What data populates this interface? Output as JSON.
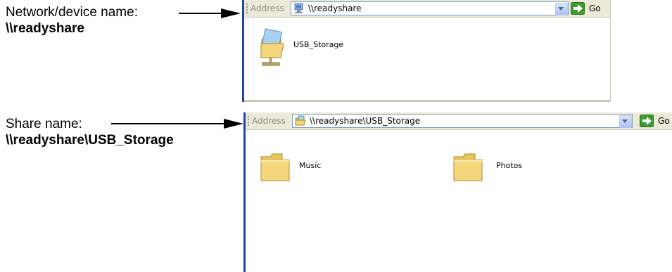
{
  "callouts": {
    "network": {
      "label": "Network/device name:",
      "value": "\\\\readyshare"
    },
    "share": {
      "label": "Share name:",
      "value": "\\\\readyshare\\USB_Storage"
    }
  },
  "window1": {
    "address_label": "Address",
    "address_value": "\\\\readyshare",
    "go_label": "Go",
    "items": [
      {
        "label": "USB_Storage",
        "icon": "shared-folder-icon"
      }
    ]
  },
  "window2": {
    "address_label": "Address",
    "address_value": "\\\\readyshare\\USB_Storage",
    "go_label": "Go",
    "items": [
      {
        "label": "Music",
        "icon": "folder-icon"
      },
      {
        "label": "Photos",
        "icon": "folder-icon"
      }
    ]
  },
  "colors": {
    "window_frame": "#1d46a8",
    "address_bar": "#ece9d8",
    "go_green": "#3c9a2f",
    "folder_yellow": "#f4d77a"
  }
}
